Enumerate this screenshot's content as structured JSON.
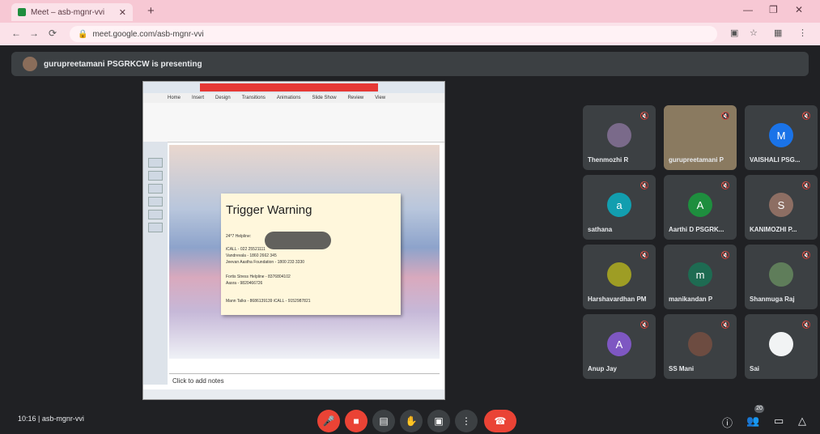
{
  "browser": {
    "tab_title": "Meet – asb-mgnr-vvi",
    "url": "meet.google.com/asb-mgnr-vvi",
    "new_tab": "+",
    "nav": {
      "back": "←",
      "forward": "→",
      "reload": "⟳"
    }
  },
  "presenter_bar": {
    "text": "gurupreetamani PSGRKCW is presenting"
  },
  "shared_screen": {
    "slide_title": "Trigger Warning",
    "slide_lines": [
      "24*7 Helpline:",
      "iCALL - 022 25521111",
      "Vandrevala - 1860 2662 345",
      "Jeevan Aastha Foundation - 1800 233 3330",
      "Fortis Stress Helpline - 8376804102",
      "Aasra - 9820466726",
      "Mann Talks - 8686139139   iCALL - 9152987821"
    ],
    "notes_placeholder": "Click to add notes",
    "ribbon_tabs": [
      "Home",
      "Insert",
      "Design",
      "Transitions",
      "Animations",
      "Slide Show",
      "Review",
      "View"
    ]
  },
  "participants": [
    {
      "name": "Thenmozhi R",
      "initial": "",
      "color": "#7a6a8a"
    },
    {
      "name": "gurupreetamani P",
      "initial": "",
      "color": "#8a7a60",
      "camera": true
    },
    {
      "name": "VAISHALI PSG...",
      "initial": "M",
      "color": "#1a73e8"
    },
    {
      "name": "sathana",
      "initial": "a",
      "color": "#129eaf"
    },
    {
      "name": "Aarthi D PSGRK...",
      "initial": "A",
      "color": "#1e8e3e"
    },
    {
      "name": "KANIMOZHI P...",
      "initial": "S",
      "color": "#8d6e63"
    },
    {
      "name": "Harshavardhan PM",
      "initial": "",
      "color": "#9e9d24"
    },
    {
      "name": "manikandan P",
      "initial": "m",
      "color": "#1e6b52"
    },
    {
      "name": "Shanmuga Raj",
      "initial": "",
      "color": "#5f7d5a"
    },
    {
      "name": "Anup Jay",
      "initial": "A",
      "color": "#7e57c2"
    },
    {
      "name": "SS Mani",
      "initial": "",
      "color": "#6d4c41"
    },
    {
      "name": "Sai",
      "initial": "",
      "color": "#f1f3f4"
    }
  ],
  "bottom": {
    "meeting_info": "10:16  |  asb-mgnr-vvi",
    "participant_count": "20"
  },
  "colors": {
    "end_call": "#ea4335",
    "muted": "#ea4335",
    "control": "#3c4043"
  }
}
